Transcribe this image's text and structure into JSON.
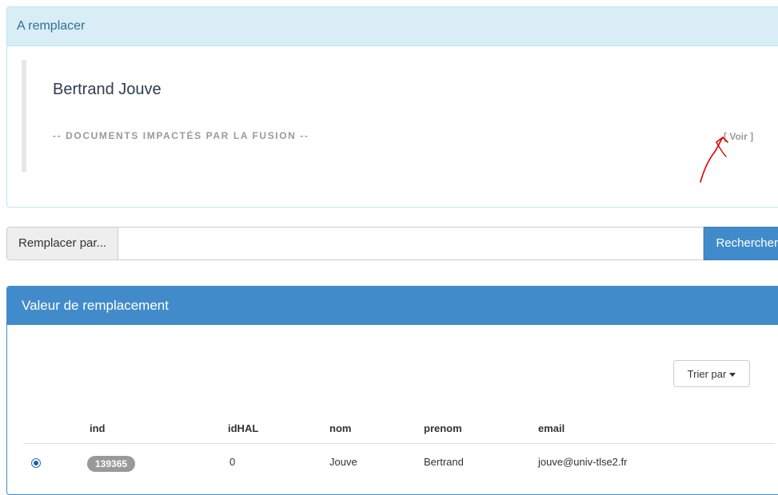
{
  "replace_panel": {
    "title": "A remplacer",
    "person_name": "Bertrand Jouve",
    "impact_label": "-- DOCUMENTS IMPACTÉS PAR LA FUSION --",
    "view_link": "[ Voir ]"
  },
  "search": {
    "addon_label": "Remplacer par...",
    "input_value": "",
    "button_label": "Rechercher"
  },
  "results_panel": {
    "title": "Valeur de remplacement",
    "sort_label": "Trier par",
    "columns": [
      "ind",
      "idHAL",
      "nom",
      "prenom",
      "email"
    ],
    "rows": [
      {
        "selected": true,
        "ind": "139365",
        "idHAL": "0",
        "nom": "Jouve",
        "prenom": "Bertrand",
        "email": "jouve@univ-tlse2.fr"
      }
    ]
  },
  "colors": {
    "info_header_bg": "#d9edf7",
    "info_header_text": "#31708f",
    "primary": "#428bca",
    "badge": "#999999",
    "annotation": "#e00000"
  }
}
